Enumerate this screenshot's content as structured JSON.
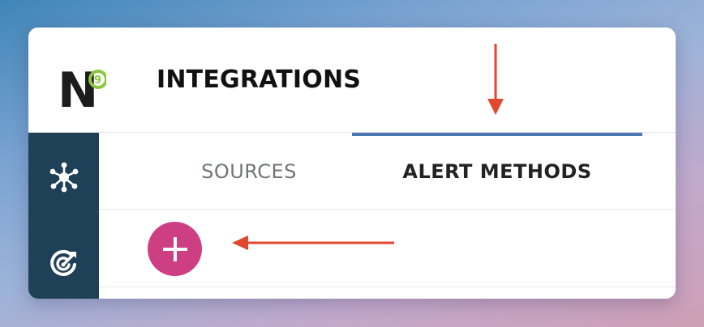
{
  "app": {
    "logo_letter": "N",
    "logo_badge": "9"
  },
  "header": {
    "title": "INTEGRATIONS"
  },
  "sidebar": {
    "items": [
      {
        "icon": "network-hub-icon"
      },
      {
        "icon": "target-rocket-icon"
      }
    ]
  },
  "tabs": [
    {
      "label": "SOURCES",
      "active": false
    },
    {
      "label": "ALERT METHODS",
      "active": true
    }
  ],
  "actions": {
    "add_icon": "plus-icon"
  },
  "colors": {
    "sidebar": "#1f4157",
    "active_tab_indicator": "#4e7ab3",
    "add_button": "#cd3f82",
    "annotation_arrow": "#e0482f",
    "logo_badge": "#8cc63f"
  }
}
